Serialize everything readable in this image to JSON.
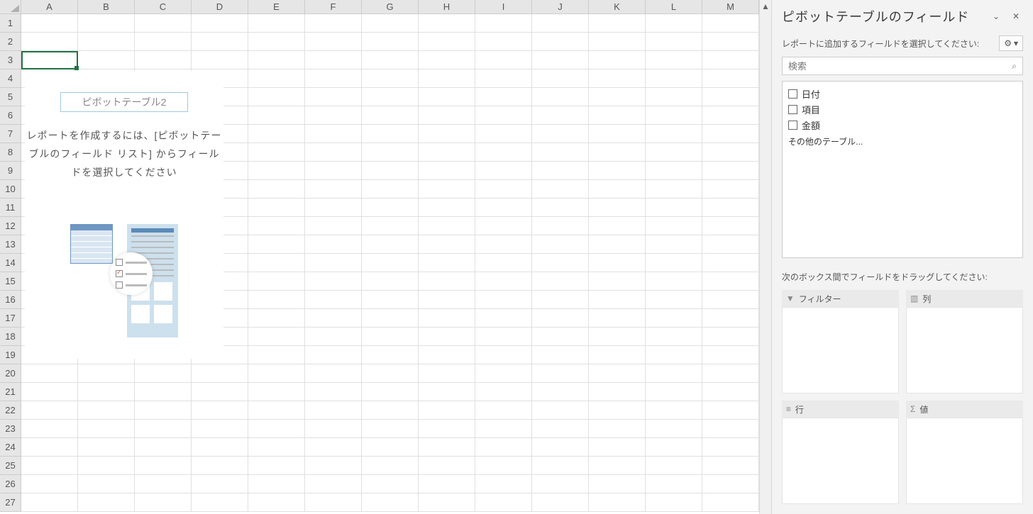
{
  "columns": [
    "A",
    "B",
    "C",
    "D",
    "E",
    "F",
    "G",
    "H",
    "I",
    "J",
    "K",
    "L",
    "M"
  ],
  "rows": [
    1,
    2,
    3,
    4,
    5,
    6,
    7,
    8,
    9,
    10,
    11,
    12,
    13,
    14,
    15,
    16,
    17,
    18,
    19,
    20,
    21,
    22,
    23,
    24,
    25,
    26,
    27
  ],
  "pivot_placeholder": {
    "title": "ピボットテーブル2",
    "message": "レポートを作成するには、[ピボットテーブルのフィールド リスト] からフィールドを選択してください"
  },
  "pane": {
    "title": "ピボットテーブルのフィールド",
    "subtitle": "レポートに追加するフィールドを選択してください:",
    "search_placeholder": "検索",
    "fields": [
      "日付",
      "項目",
      "金額"
    ],
    "more_tables": "その他のテーブル...",
    "drag_hint": "次のボックス間でフィールドをドラッグしてください:",
    "areas": {
      "filter": "フィルター",
      "columns": "列",
      "rows": "行",
      "values": "値"
    }
  },
  "icons": {
    "gear": "⚙",
    "dropdown": "▾",
    "chevron": "⌄",
    "close": "✕",
    "search": "⌕",
    "filter": "▼",
    "col": "▥",
    "row": "≡",
    "sigma": "Σ",
    "up": "▲"
  }
}
